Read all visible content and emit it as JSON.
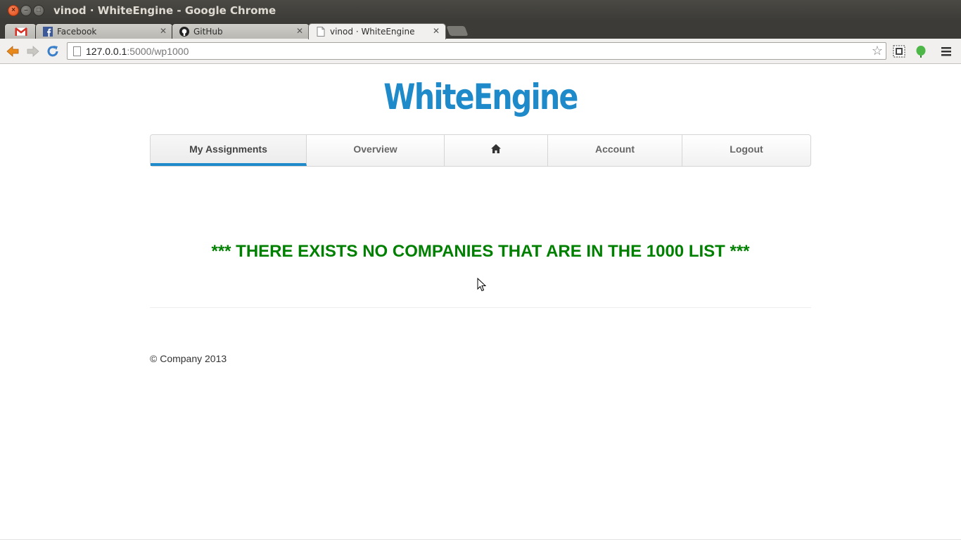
{
  "window": {
    "title": "vinod · WhiteEngine - Google Chrome"
  },
  "tabs": [
    {
      "label": "",
      "icon": "gmail-icon"
    },
    {
      "label": "Facebook",
      "icon": "facebook-icon"
    },
    {
      "label": "GitHub",
      "icon": "github-icon"
    },
    {
      "label": "vinod · WhiteEngine",
      "icon": "page-icon"
    }
  ],
  "toolbar": {
    "url_host": "127.0.0.1",
    "url_rest": ":5000/wp1000"
  },
  "site": {
    "logo": "WhiteEngine",
    "accent_color": "#1e8ac9"
  },
  "nav": {
    "items": [
      {
        "label": "My Assignments"
      },
      {
        "label": "Overview"
      },
      {
        "label": "",
        "icon": "home-icon"
      },
      {
        "label": "Account"
      },
      {
        "label": "Logout"
      }
    ]
  },
  "main": {
    "message": "*** THERE EXISTS NO COMPANIES THAT ARE IN THE 1000 LIST ***",
    "message_color": "#008000"
  },
  "footer": {
    "copyright": "© Company 2013"
  }
}
